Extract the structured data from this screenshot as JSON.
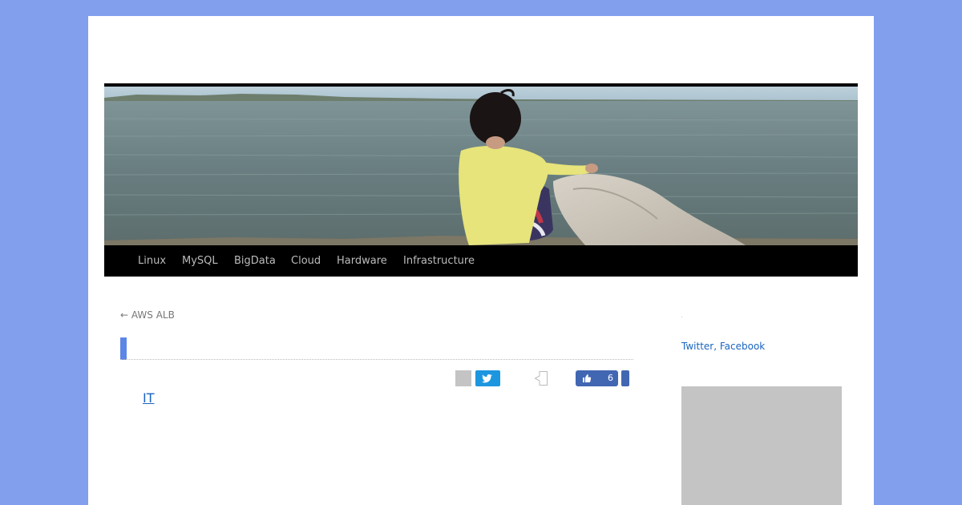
{
  "nav": {
    "items": [
      {
        "label": "Linux"
      },
      {
        "label": "MySQL"
      },
      {
        "label": "BigData"
      },
      {
        "label": "Cloud"
      },
      {
        "label": "Hardware"
      },
      {
        "label": "Infrastructure"
      }
    ]
  },
  "post": {
    "prev_link": "← AWS ALB",
    "category": "IT"
  },
  "share": {
    "like_count": "6"
  },
  "sidebar": {
    "sns_twitter": "Twitter",
    "sns_separator": ", ",
    "sns_facebook": "Facebook"
  },
  "colors": {
    "page_background": "#829fee",
    "nav_background": "#000000",
    "link": "#1a64bf",
    "twitter": "#1d96e0",
    "facebook": "#4267b2",
    "title_marker": "#5c86e6"
  },
  "icons": {
    "tweet": "twitter-bird-icon",
    "like": "thumbs-up-icon",
    "bookmark": "bookmark-icon"
  }
}
